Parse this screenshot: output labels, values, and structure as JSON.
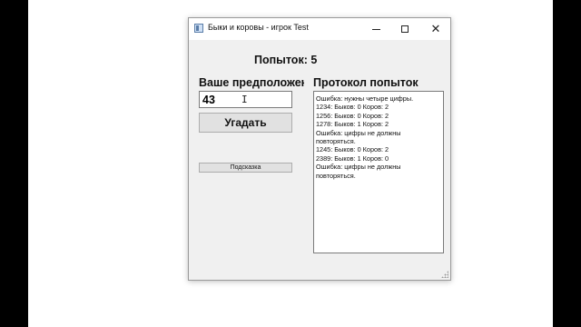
{
  "window": {
    "title": "Быки и коровы - игрок Test",
    "icon": "app-window-icon",
    "controls": {
      "minimize": "minimize-icon",
      "maximize": "maximize-icon",
      "close": "✕"
    }
  },
  "attempts_label": "Попыток: 5",
  "guess": {
    "label": "Ваше предположение",
    "value": "43",
    "submit_label": "Угадать",
    "hint_label": "Подсказка"
  },
  "log": {
    "label": "Протокол попыток",
    "lines": [
      "Ошибка: нужны четыре цифры.",
      "1234: Быков: 0 Коров: 2",
      "1256: Быков: 0 Коров: 2",
      "1278: Быков: 1 Коров: 2",
      "Ошибка: цифры не должны",
      "повторяться.",
      "1245: Быков: 0 Коров: 2",
      "2389: Быков: 1 Коров: 0",
      "Ошибка: цифры не должны",
      "повторяться."
    ]
  },
  "colors": {
    "desktop": "#000000",
    "screen": "#ffffff",
    "window_bg": "#f0f0f0",
    "button_bg": "#e1e1e1"
  }
}
